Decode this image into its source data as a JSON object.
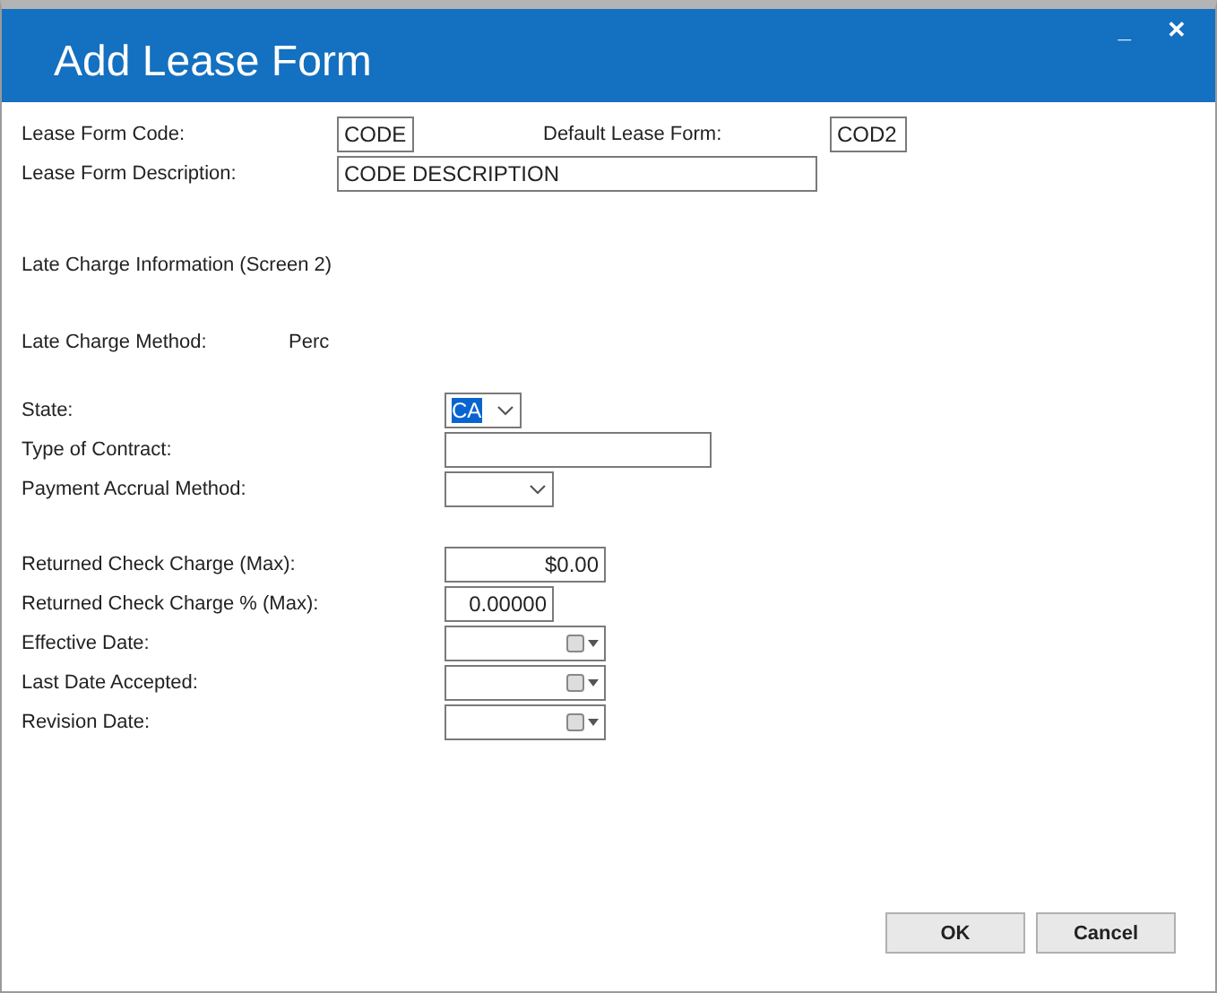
{
  "window": {
    "title": "Add Lease Form",
    "controls": [
      "_",
      "✕"
    ]
  },
  "header": {
    "code": {
      "label": "Lease Form Code:",
      "value": "CODE"
    },
    "default": {
      "label": "Default Lease Form:",
      "value": "COD2"
    },
    "description": {
      "label": "Lease Form Description:",
      "value": "CODE DESCRIPTION"
    }
  },
  "section_title": "Late Charge Information (Screen 2)",
  "late_charge_method": {
    "label": "Late Charge Method:",
    "value": "Perc"
  },
  "group_1": [
    {
      "kind": "combo",
      "label": "State:",
      "value": "CA",
      "selected": true
    },
    {
      "kind": "text",
      "label": "Type of Contract:"
    },
    {
      "kind": "combo",
      "label": "Payment Accrual Method:"
    }
  ],
  "group_2": [
    {
      "kind": "number",
      "label": "Returned Check Charge (Max):",
      "value": "$0.00"
    },
    {
      "kind": "number",
      "label": "Returned Check Charge % (Max):",
      "value": "0.00000"
    },
    {
      "kind": "date",
      "label": "Effective Date:"
    },
    {
      "kind": "date",
      "label": "Last Date Accepted:"
    },
    {
      "kind": "date",
      "label": "Revision Date:"
    }
  ],
  "buttons": [
    "OK",
    "Cancel"
  ]
}
